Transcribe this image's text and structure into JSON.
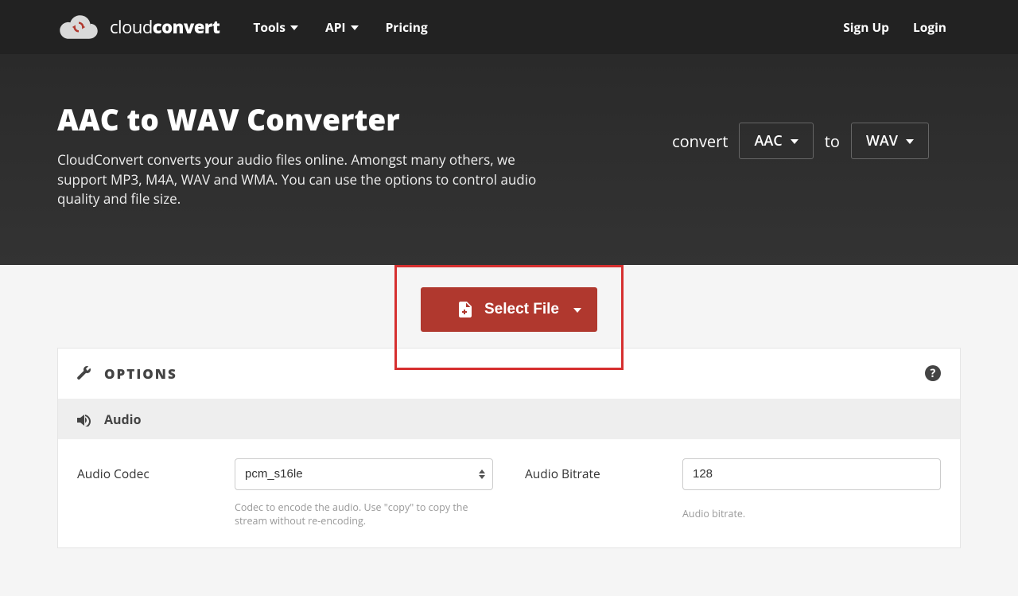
{
  "brand": {
    "light": "cloud",
    "bold": "convert"
  },
  "nav": {
    "tools": "Tools",
    "api": "API",
    "pricing": "Pricing"
  },
  "auth": {
    "signup": "Sign Up",
    "login": "Login"
  },
  "hero": {
    "title": "AAC to WAV Converter",
    "description": "CloudConvert converts your audio files online. Amongst many others, we support MP3, M4A, WAV and WMA. You can use the options to control audio quality and file size.",
    "convert_label": "convert",
    "from_format": "AAC",
    "to_label": "to",
    "to_format": "WAV"
  },
  "select_file": "Select File",
  "options": {
    "title": "OPTIONS",
    "audio_section": "Audio",
    "codec": {
      "label": "Audio Codec",
      "value": "pcm_s16le",
      "help": "Codec to encode the audio. Use \"copy\" to copy the stream without re-encoding."
    },
    "bitrate": {
      "label": "Audio Bitrate",
      "value": "128",
      "help": "Audio bitrate."
    }
  }
}
